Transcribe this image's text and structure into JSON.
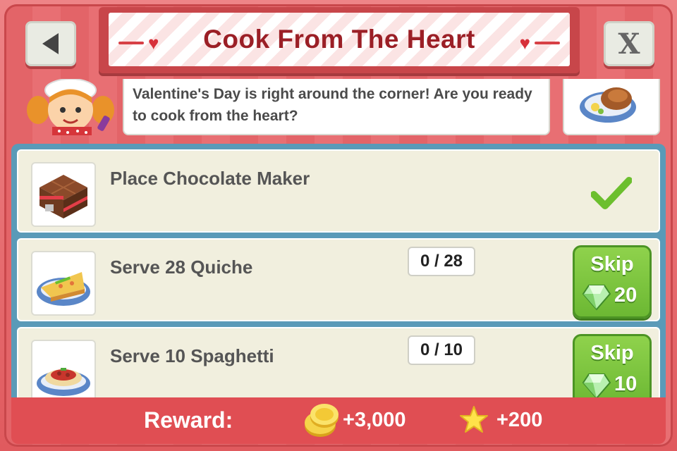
{
  "header": {
    "title": "Cook From The Heart",
    "back_icon": "back-arrow-icon",
    "close_label": "X"
  },
  "intro": {
    "message": "Valentine's Day is right around the corner! Are you ready to cook from the heart?"
  },
  "tasks": [
    {
      "label": "Place Chocolate Maker",
      "completed": true,
      "icon": "chocolate-cake-icon"
    },
    {
      "label": "Serve 28 Quiche",
      "progress": "0 / 28",
      "skip_label": "Skip",
      "skip_cost": "20",
      "icon": "quiche-icon"
    },
    {
      "label": "Serve 10 Spaghetti",
      "progress": "0 / 10",
      "skip_label": "Skip",
      "skip_cost": "10",
      "icon": "spaghetti-icon"
    }
  ],
  "reward": {
    "label": "Reward:",
    "coins": "+3,000",
    "xp": "+200"
  },
  "colors": {
    "frame": "#e46b6e",
    "title": "#9b1f26",
    "skip_green": "#7cc43f",
    "panel_blue": "#5a9ab8"
  }
}
